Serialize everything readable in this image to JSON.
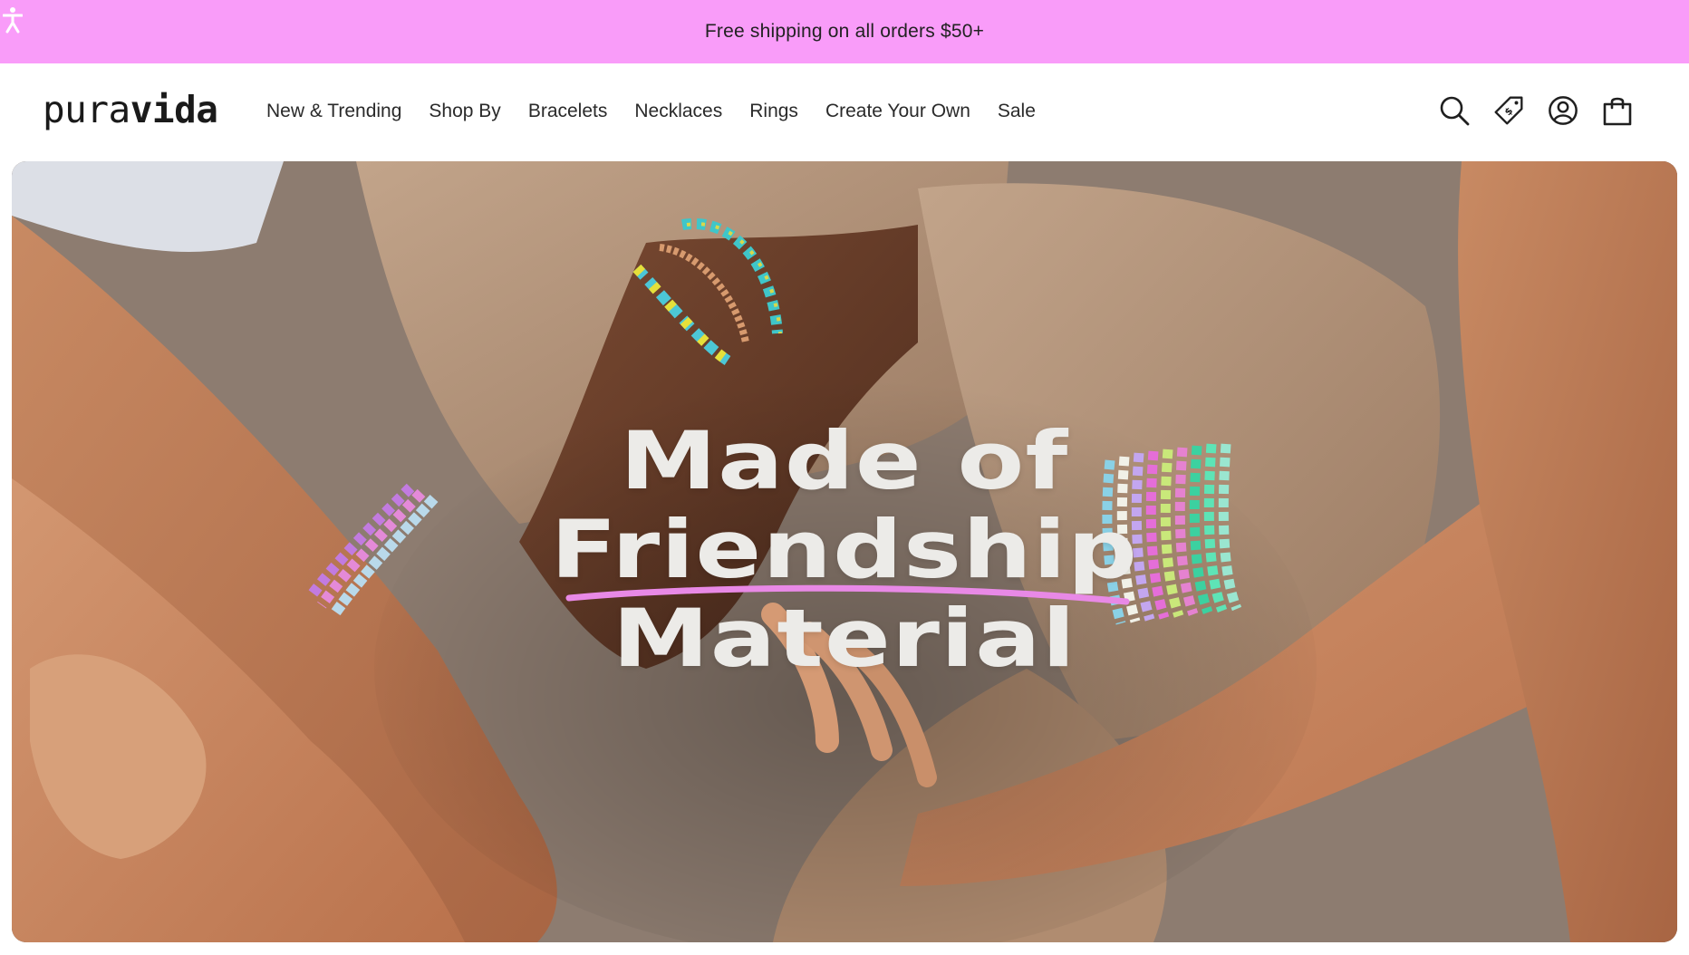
{
  "announcement": {
    "text": "Free shipping on all orders $50+",
    "background": "#f99cf9"
  },
  "accessibility": {
    "icon": "accessibility-icon"
  },
  "header": {
    "logo_regular": "pura",
    "logo_bold": "vida",
    "nav": [
      {
        "label": "New & Trending"
      },
      {
        "label": "Shop By"
      },
      {
        "label": "Bracelets"
      },
      {
        "label": "Necklaces"
      },
      {
        "label": "Rings"
      },
      {
        "label": "Create Your Own"
      },
      {
        "label": "Sale"
      }
    ],
    "icons": [
      "search-icon",
      "price-tag-icon",
      "account-icon",
      "shopping-bag-icon"
    ]
  },
  "hero": {
    "headline": [
      "Made of",
      "Friendship",
      "Material"
    ],
    "underline_color": "#e889e6",
    "image": "hands-with-friendship-bracelets"
  }
}
